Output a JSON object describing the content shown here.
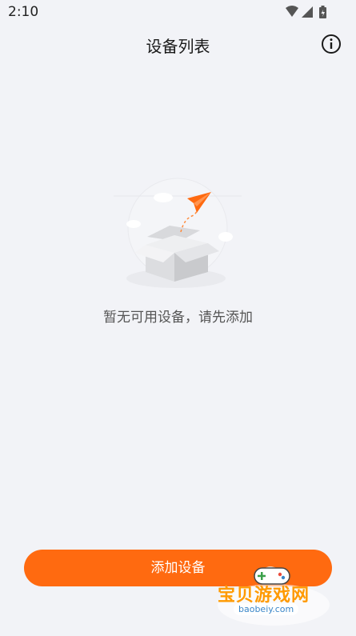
{
  "status_bar": {
    "time": "2:10",
    "icons": [
      "wifi-icon",
      "cellular-signal-icon",
      "battery-icon"
    ]
  },
  "header": {
    "title": "设备列表",
    "info_icon": "info-icon"
  },
  "empty_state": {
    "illustration_icon": "empty-box-paper-plane-illustration",
    "message": "暂无可用设备，请先添加"
  },
  "actions": {
    "add_device_label": "添加设备"
  },
  "watermark": {
    "name": "宝贝游戏网",
    "url": "baobeiy.com"
  },
  "colors": {
    "accent": "#ff6a10",
    "background": "#f2f3f7"
  }
}
